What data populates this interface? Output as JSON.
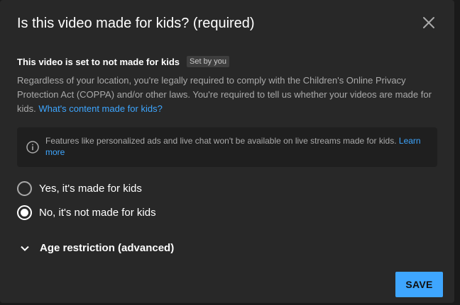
{
  "dialog": {
    "title": "Is this video made for kids? (required)",
    "close_icon": "close-icon"
  },
  "status": {
    "text": "This video is set to not made for kids",
    "badge": "Set by you"
  },
  "description": {
    "text": "Regardless of your location, you're legally required to comply with the Children's Online Privacy Protection Act (COPPA) and/or other laws. You're required to tell us whether your videos are made for kids.",
    "link": "What's content made for kids?"
  },
  "notice": {
    "icon": "info-icon",
    "text": "Features like personalized ads and live chat won't be available on live streams made for kids.",
    "link": "Learn more"
  },
  "options": [
    {
      "label": "Yes, it's made for kids",
      "selected": false
    },
    {
      "label": "No, it's not made for kids",
      "selected": true
    }
  ],
  "age_restriction": {
    "icon": "chevron-down-icon",
    "label": "Age restriction (advanced)"
  },
  "actions": {
    "save_label": "SAVE"
  },
  "colors": {
    "dialog_bg": "#282828",
    "accent": "#3ea6ff",
    "secondary_text": "#aaaaaa"
  }
}
